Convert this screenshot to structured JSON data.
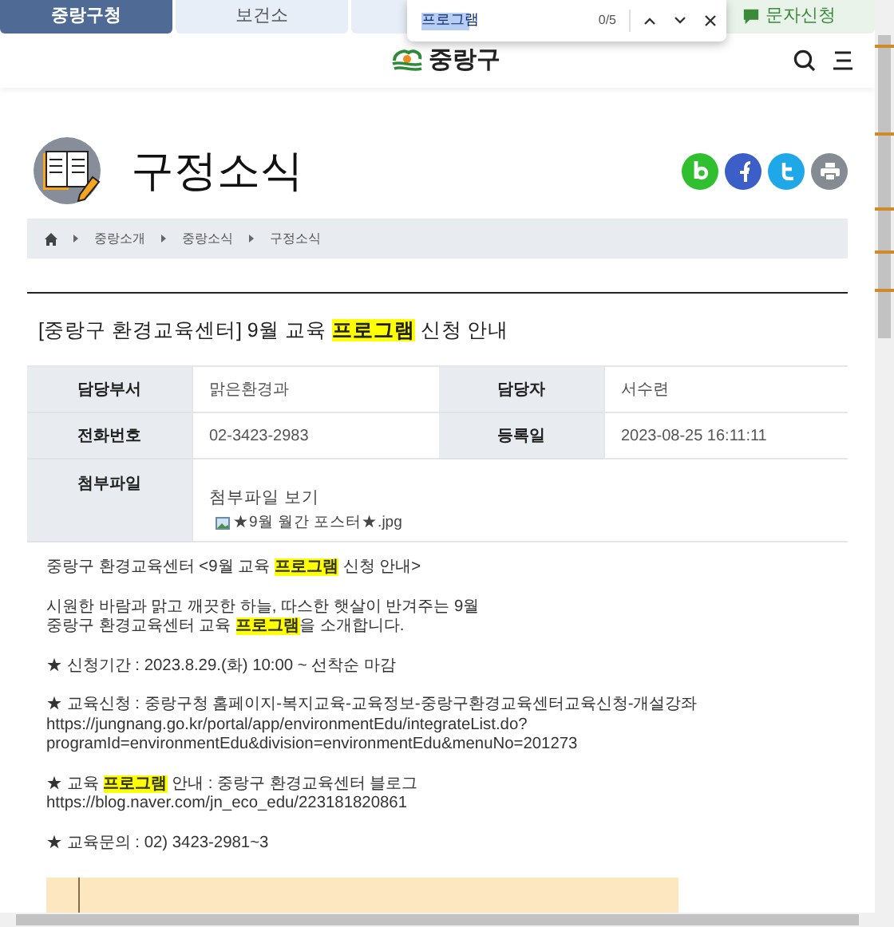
{
  "top_tabs": [
    {
      "label": "중랑구청",
      "selected": true
    },
    {
      "label": "보건소",
      "selected": false
    },
    {
      "selected": false
    }
  ],
  "sms_button": {
    "label": "문자신청"
  },
  "find_bar": {
    "query": "프로그램",
    "count": "0/5"
  },
  "logo": {
    "text": "중랑구"
  },
  "page": {
    "title": "구정소식"
  },
  "breadcrumb": [
    "중랑소개",
    "중랑소식",
    "구정소식"
  ],
  "post": {
    "title": "[중랑구 환경교육센터] 9월 교육 **프로그램** 신청 안내",
    "meta": [
      {
        "label": "담당부서",
        "value": "맑은환경과"
      },
      {
        "label": "담당자",
        "value": "서수련"
      },
      {
        "label": "전화번호",
        "value": "02-3423-2983"
      },
      {
        "label": "등록일",
        "value": "2023-08-25 16:11:11"
      }
    ],
    "attachment": {
      "label": "첨부파일",
      "link": "첨부파일 보기",
      "file": "★9월 월간 포스터★.jpg"
    },
    "body": [
      [
        "중랑구 환경교육센터 <9월 교육 **프로그램** 신청 안내>"
      ],
      [
        "시원한 바람과 맑고 깨끗한 하늘, 따스한 햇살이 반겨주는 9월",
        "중랑구 환경교육센터 교육 **프로그램**을 소개합니다."
      ],
      [
        "★ 신청기간 : 2023.8.29.(화) 10:00 ~ 선착순 마감"
      ],
      [
        "★ 교육신청 : 중랑구청 홈페이지-복지교육-교육정보-중랑구환경교육센터교육신청-개설강좌",
        "https://jungnang.go.kr/portal/app/environmentEdu/integrateList.do?",
        "programId=environmentEdu&division=environmentEdu&menuNo=201273"
      ],
      [
        "★ 교육 **프로그램** 안내 : 중랑구 환경교육센터 블로그",
        "https://blog.naver.com/jn_eco_edu/223181820861"
      ],
      [
        "★ 교육문의 : 02) 3423-2981~3"
      ]
    ]
  }
}
